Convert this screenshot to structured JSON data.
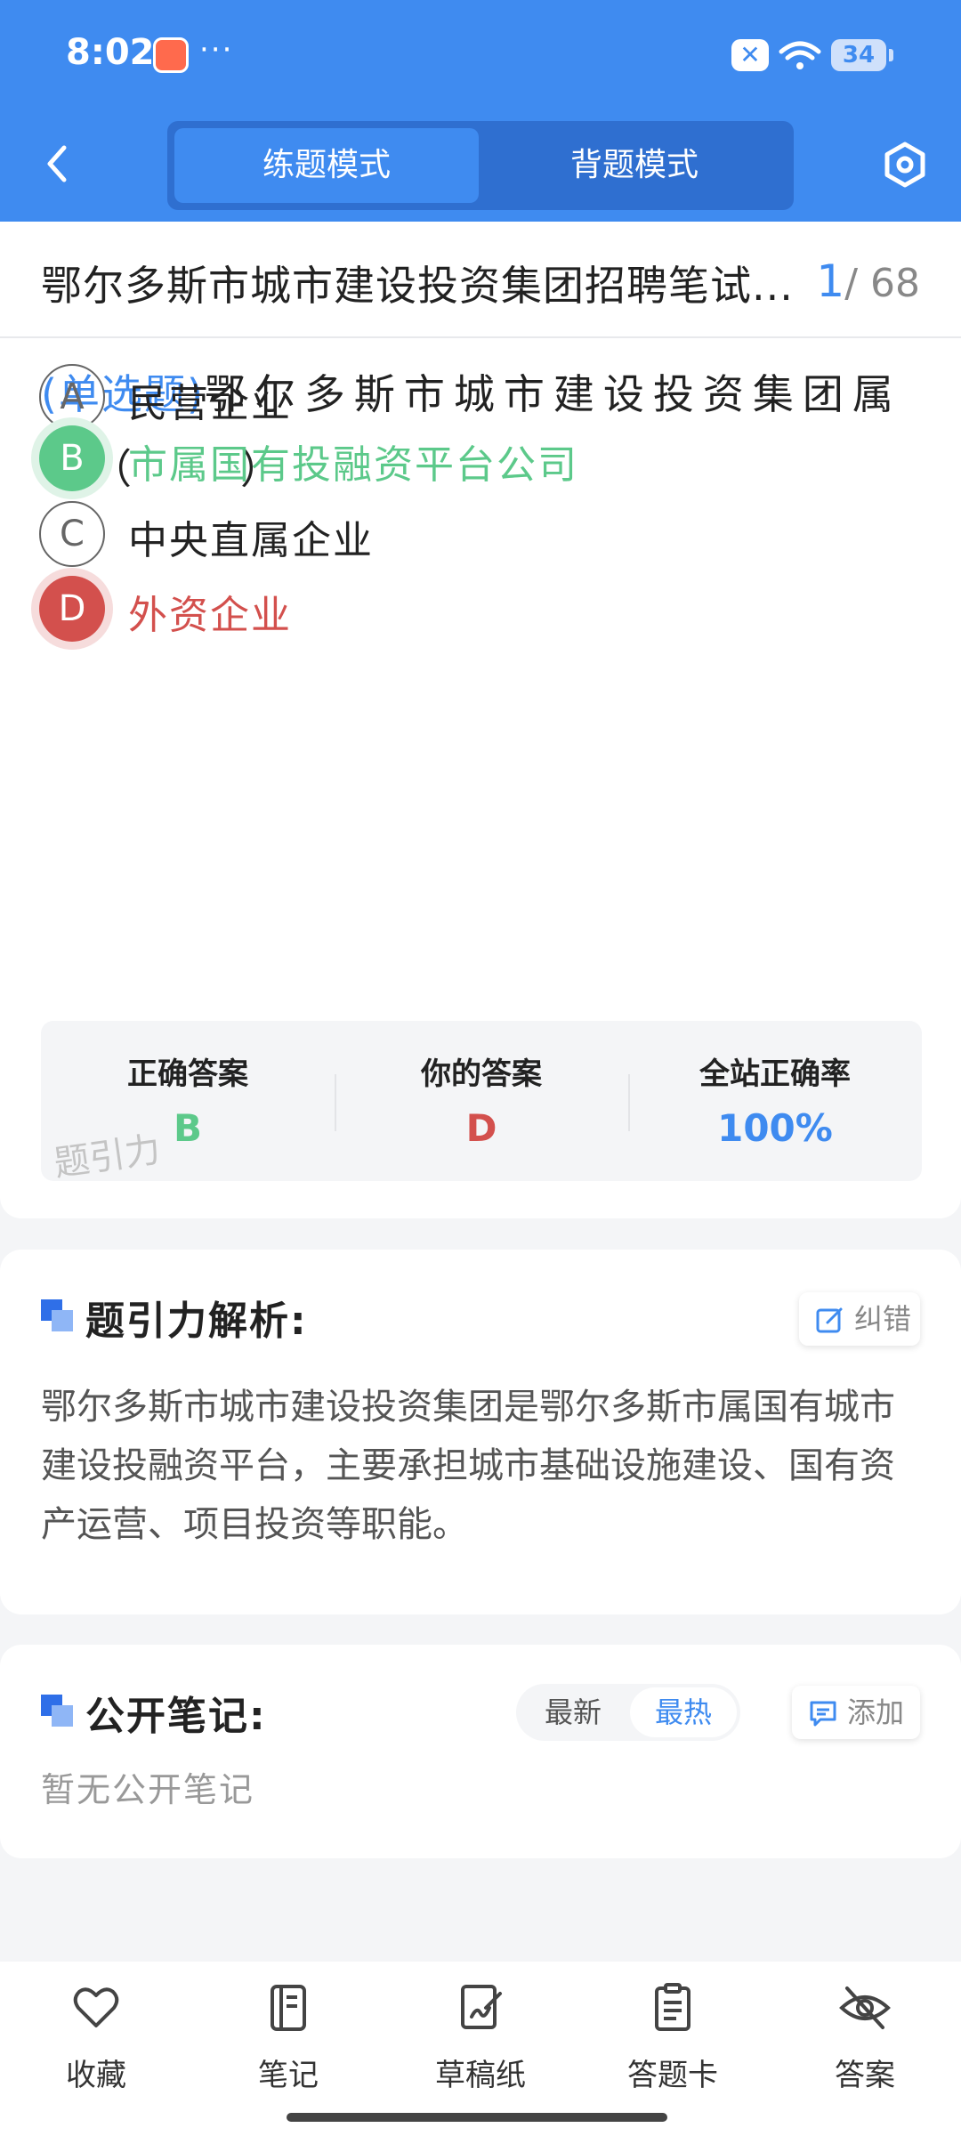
{
  "status_bar": {
    "time": "8:02",
    "more": "···",
    "battery": "34"
  },
  "header": {
    "tabs": [
      {
        "label": "练题模式",
        "active": true
      },
      {
        "label": "背题模式",
        "active": false
      }
    ]
  },
  "question": {
    "title": "鄂尔多斯市城市建设投资集团招聘笔试...",
    "current": "1",
    "total": "/ 68",
    "type_label": "(单选题)",
    "stem": "鄂尔多斯市城市建设投资集团属于（　　）",
    "options": [
      {
        "letter": "A",
        "text": "民营企业",
        "state": "normal"
      },
      {
        "letter": "B",
        "text": "市属国有投融资平台公司",
        "state": "correct"
      },
      {
        "letter": "C",
        "text": "中央直属企业",
        "state": "normal"
      },
      {
        "letter": "D",
        "text": "外资企业",
        "state": "wrong"
      }
    ]
  },
  "result": {
    "correct_label": "正确答案",
    "correct_value": "B",
    "your_label": "你的答案",
    "your_value": "D",
    "rate_label": "全站正确率",
    "rate_value": "100%",
    "watermark": "题引力"
  },
  "analysis": {
    "title": "题引力解析:",
    "report_label": "纠错",
    "text": "鄂尔多斯市城市建设投资集团是鄂尔多斯市属国有城市建设投融资平台，主要承担城市基础设施建设、国有资产运营、项目投资等职能。"
  },
  "notes": {
    "title": "公开笔记:",
    "sort_options": [
      "最新",
      "最热"
    ],
    "sort_selected": "最热",
    "add_label": "添加",
    "empty_text": "暂无公开笔记"
  },
  "bottom_nav": [
    {
      "label": "收藏",
      "icon": "heart-icon"
    },
    {
      "label": "笔记",
      "icon": "notebook-icon"
    },
    {
      "label": "草稿纸",
      "icon": "draft-icon"
    },
    {
      "label": "答题卡",
      "icon": "answer-card-icon"
    },
    {
      "label": "答案",
      "icon": "eye-off-icon"
    }
  ],
  "colors": {
    "brand": "#3f8bf0",
    "correct": "#5cc98a",
    "wrong": "#d3504d"
  }
}
